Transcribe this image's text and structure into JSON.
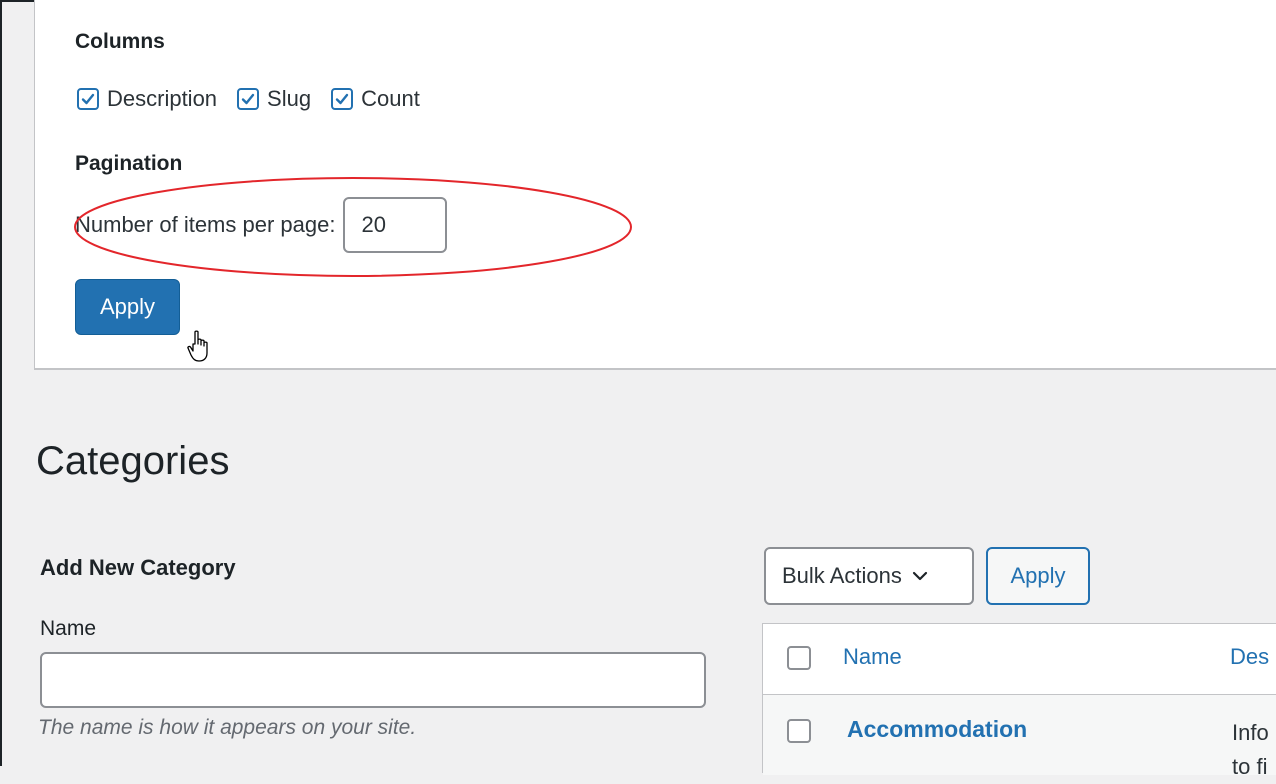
{
  "screen_options": {
    "columns_heading": "Columns",
    "columns": [
      {
        "label": "Description",
        "checked": true
      },
      {
        "label": "Slug",
        "checked": true
      },
      {
        "label": "Count",
        "checked": true
      }
    ],
    "pagination_heading": "Pagination",
    "items_per_page_label": "Number of items per page:",
    "items_per_page_value": "20",
    "apply_label": "Apply",
    "highlight_color": "#e3262b"
  },
  "page_title": "Categories",
  "add_new": {
    "heading": "Add New Category",
    "name_label": "Name",
    "name_value": "",
    "name_help": "The name is how it appears on your site."
  },
  "bulk_actions": {
    "selected": "Bulk Actions",
    "apply_label": "Apply"
  },
  "table": {
    "columns": [
      "Name",
      "Des"
    ],
    "rows": [
      {
        "name": "Accommodation",
        "description_line1": "Info",
        "description_line2": "to fi"
      }
    ]
  },
  "colors": {
    "accent": "#2271b1",
    "background": "#f0f0f1"
  }
}
